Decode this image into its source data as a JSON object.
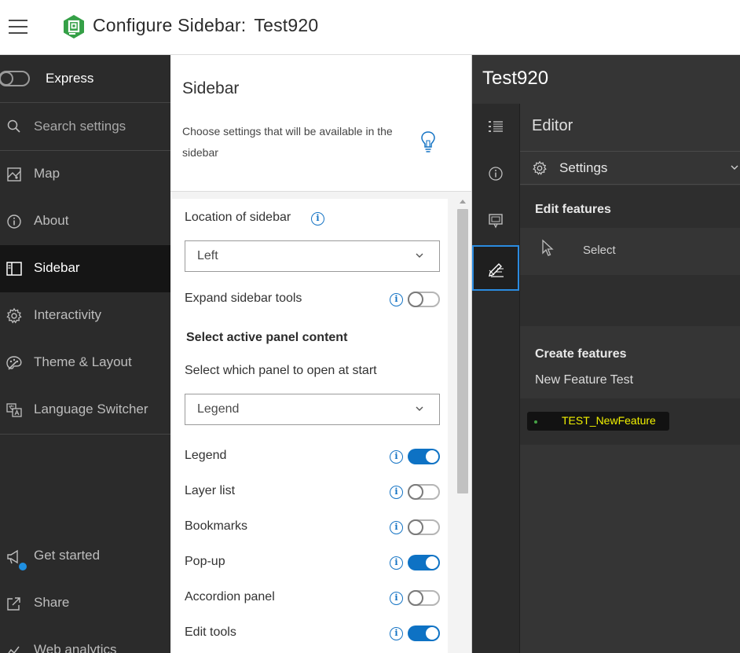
{
  "header": {
    "title": "Configure Sidebar:",
    "app_name": "Test920"
  },
  "leftnav": {
    "express_label": "Express",
    "express_on": false,
    "search_placeholder": "Search settings",
    "items": [
      {
        "label": "Map",
        "icon": "map-icon"
      },
      {
        "label": "About",
        "icon": "info-icon"
      },
      {
        "label": "Sidebar",
        "icon": "sidebar-icon",
        "active": true
      },
      {
        "label": "Interactivity",
        "icon": "gear-icon"
      },
      {
        "label": "Theme & Layout",
        "icon": "palette-icon"
      },
      {
        "label": "Language Switcher",
        "icon": "language-icon"
      }
    ],
    "footer_items": [
      {
        "label": "Get started",
        "icon": "megaphone-icon"
      },
      {
        "label": "Share",
        "icon": "share-icon"
      },
      {
        "label": "Web analytics",
        "icon": "analytics-icon"
      }
    ]
  },
  "config": {
    "title": "Sidebar",
    "description": "Choose settings that will be available in the sidebar",
    "location_label": "Location of sidebar",
    "location_value": "Left",
    "expand_label": "Expand sidebar tools",
    "expand_on": false,
    "section_heading": "Select active panel content",
    "panel_label": "Select which panel to open at start",
    "panel_value": "Legend",
    "toggles": [
      {
        "label": "Legend",
        "on": true
      },
      {
        "label": "Layer list",
        "on": false
      },
      {
        "label": "Bookmarks",
        "on": false
      },
      {
        "label": "Pop-up",
        "on": true
      },
      {
        "label": "Accordion panel",
        "on": false
      },
      {
        "label": "Edit tools",
        "on": true
      }
    ]
  },
  "preview": {
    "title": "Test920",
    "rail_icons": [
      "list-icon",
      "info-icon",
      "popup-icon",
      "edit-icon"
    ],
    "active_rail": "edit-icon",
    "editor_title": "Editor",
    "settings_label": "Settings",
    "edit_heading": "Edit features",
    "select_label": "Select",
    "create_heading": "Create features",
    "layer_name": "New Feature Test",
    "template_label": "TEST_NewFeature"
  },
  "colors": {
    "accent": "#0e72c4",
    "nav_bg": "#2b2b2b",
    "preview_bg": "#353535",
    "template_text": "#f2f200",
    "logo": "#35a047"
  }
}
